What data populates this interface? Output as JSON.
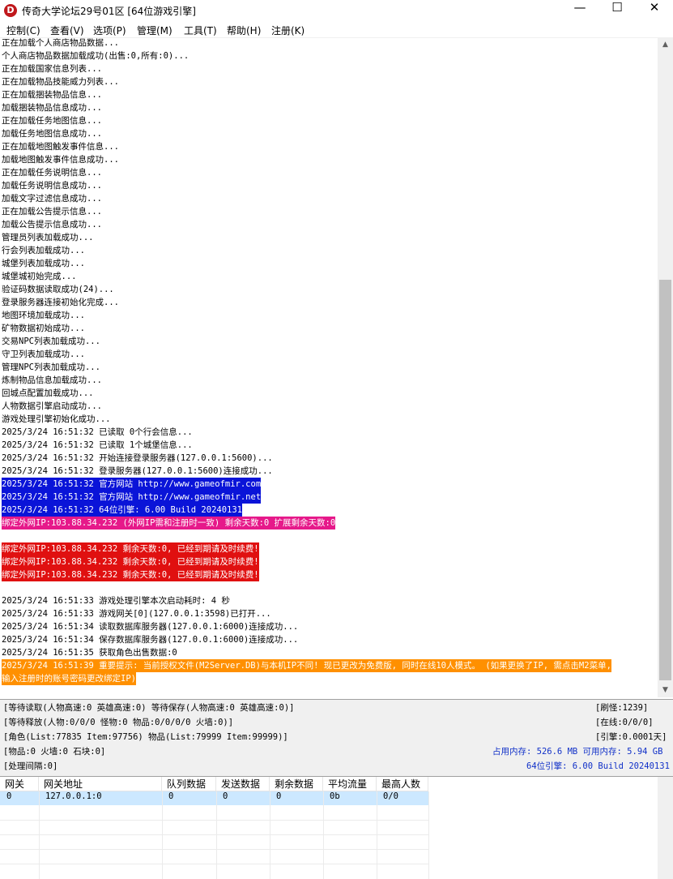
{
  "window": {
    "title": "传奇大学论坛29号01区 [64位游戏引擎]",
    "app_icon_letter": "D",
    "min_glyph": "—",
    "max_glyph": "☐",
    "close_glyph": "✕"
  },
  "menu": [
    "控制(C)",
    "查看(V)",
    "选项(P)",
    "管理(M)",
    "工具(T)",
    "帮助(H)",
    "注册(K)"
  ],
  "log_lines": [
    {
      "text": "正在加载个人商店物品数据...",
      "style": "normal"
    },
    {
      "text": "个人商店物品数据加载成功(出售:0,所有:0)...",
      "style": "normal"
    },
    {
      "text": "正在加载国家信息列表...",
      "style": "normal"
    },
    {
      "text": "正在加载物品技能威力列表...",
      "style": "normal"
    },
    {
      "text": "正在加载捆装物品信息...",
      "style": "normal"
    },
    {
      "text": "加载捆装物品信息成功...",
      "style": "normal"
    },
    {
      "text": "正在加载任务地图信息...",
      "style": "normal"
    },
    {
      "text": "加载任务地图信息成功...",
      "style": "normal"
    },
    {
      "text": "正在加载地图触发事件信息...",
      "style": "normal"
    },
    {
      "text": "加载地图触发事件信息成功...",
      "style": "normal"
    },
    {
      "text": "正在加载任务说明信息...",
      "style": "normal"
    },
    {
      "text": "加载任务说明信息成功...",
      "style": "normal"
    },
    {
      "text": "加载文字过滤信息成功...",
      "style": "normal"
    },
    {
      "text": "正在加载公告提示信息...",
      "style": "normal"
    },
    {
      "text": "加载公告提示信息成功...",
      "style": "normal"
    },
    {
      "text": "管理员列表加载成功...",
      "style": "normal"
    },
    {
      "text": "行会列表加载成功...",
      "style": "normal"
    },
    {
      "text": "城堡列表加载成功...",
      "style": "normal"
    },
    {
      "text": "城堡城初始完成...",
      "style": "normal"
    },
    {
      "text": "验证码数据读取成功(24)...",
      "style": "normal"
    },
    {
      "text": "登录服务器连接初始化完成...",
      "style": "normal"
    },
    {
      "text": "地图环境加载成功...",
      "style": "normal"
    },
    {
      "text": "矿物数据初始成功...",
      "style": "normal"
    },
    {
      "text": "交易NPC列表加载成功...",
      "style": "normal"
    },
    {
      "text": "守卫列表加载成功...",
      "style": "normal"
    },
    {
      "text": "管理NPC列表加载成功...",
      "style": "normal"
    },
    {
      "text": "炼制物品信息加载成功...",
      "style": "normal"
    },
    {
      "text": "回城点配置加载成功...",
      "style": "normal"
    },
    {
      "text": "人物数据引擎启动成功...",
      "style": "normal"
    },
    {
      "text": "游戏处理引擎初始化成功...",
      "style": "normal"
    },
    {
      "text": "2025/3/24 16:51:32 已读取 0个行会信息...",
      "style": "normal"
    },
    {
      "text": "2025/3/24 16:51:32 已读取 1个城堡信息...",
      "style": "normal"
    },
    {
      "text": "2025/3/24 16:51:32 开始连接登录服务器(127.0.0.1:5600)...",
      "style": "normal"
    },
    {
      "text": "2025/3/24 16:51:32 登录服务器(127.0.0.1:5600)连接成功...",
      "style": "normal"
    },
    {
      "text": "2025/3/24 16:51:32 官方网站 http://www.gameofmir.com",
      "style": "blue"
    },
    {
      "text": "2025/3/24 16:51:32 官方网站 http://www.gameofmir.net",
      "style": "blue"
    },
    {
      "text": "2025/3/24 16:51:32 64位引擎: 6.00 Build 20240131",
      "style": "blue"
    },
    {
      "text": "绑定外网IP:103.88.34.232 (外网IP需和注册时一致) 剩余天数:0 扩展剩余天数:0",
      "style": "magenta"
    },
    {
      "text": "",
      "style": "normal"
    },
    {
      "text": "绑定外网IP:103.88.34.232 剩余天数:0, 已经到期请及时续费!",
      "style": "red"
    },
    {
      "text": "绑定外网IP:103.88.34.232 剩余天数:0, 已经到期请及时续费!",
      "style": "red"
    },
    {
      "text": "绑定外网IP:103.88.34.232 剩余天数:0, 已经到期请及时续费!",
      "style": "red"
    },
    {
      "text": "",
      "style": "normal"
    },
    {
      "text": "2025/3/24 16:51:33 游戏处理引擎本次启动耗时: 4 秒",
      "style": "normal"
    },
    {
      "text": "2025/3/24 16:51:33 游戏网关[0](127.0.0.1:3598)已打开...",
      "style": "normal"
    },
    {
      "text": "2025/3/24 16:51:34 读取数据库服务器(127.0.0.1:6000)连接成功...",
      "style": "normal"
    },
    {
      "text": "2025/3/24 16:51:34 保存数据库服务器(127.0.0.1:6000)连接成功...",
      "style": "normal"
    },
    {
      "text": "2025/3/24 16:51:35 获取角色出售数据:0",
      "style": "normal"
    },
    {
      "text": "2025/3/24 16:51:39 重要提示: 当前授权文件(M2Server.DB)与本机IP不同! 现已更改为免费版, 同时在线10人模式。 (如果更换了IP, 需点击M2菜单,",
      "style": "orange"
    },
    {
      "text": "输入注册时的账号密码更改绑定IP)",
      "style": "orange"
    }
  ],
  "status": {
    "line1": "[等待读取(人物高速:0 英雄高速:0) 等待保存(人物高速:0 英雄高速:0)]",
    "line2": "[等待释放(人物:0/0/0 怪物:0 物品:0/0/0/0 火墙:0)]",
    "line3": "[角色(List:77835 Item:97756) 物品(List:79999 Item:99999)]",
    "line4": "[物品:0 火墙:0 石块:0]",
    "line5": "[处理间隔:0]",
    "refresh_monster": "[刷怪:1239]",
    "online": "[在线:0/0/0]",
    "engine_interval": "[引擎:0.0001天]",
    "memory": "占用内存: 526.6 MB 可用内存: 5.94 GB",
    "engine_version": "64位引擎: 6.00 Build 20240131"
  },
  "gateway_table": {
    "headers": [
      "网关",
      "网关地址",
      "队列数据",
      "发送数据",
      "剩余数据",
      "平均流量",
      "最高人数"
    ],
    "rows": [
      [
        "0",
        "127.0.0.1:0",
        "0",
        "0",
        "0",
        "0b",
        "0/0"
      ]
    ]
  },
  "colors": {
    "blue_highlight": "#0a14d8",
    "magenta_highlight": "#e6198a",
    "red_highlight": "#e01010",
    "orange_highlight": "#ff9000",
    "selected_row": "#cce8ff",
    "status_blue": "#1030c8"
  }
}
